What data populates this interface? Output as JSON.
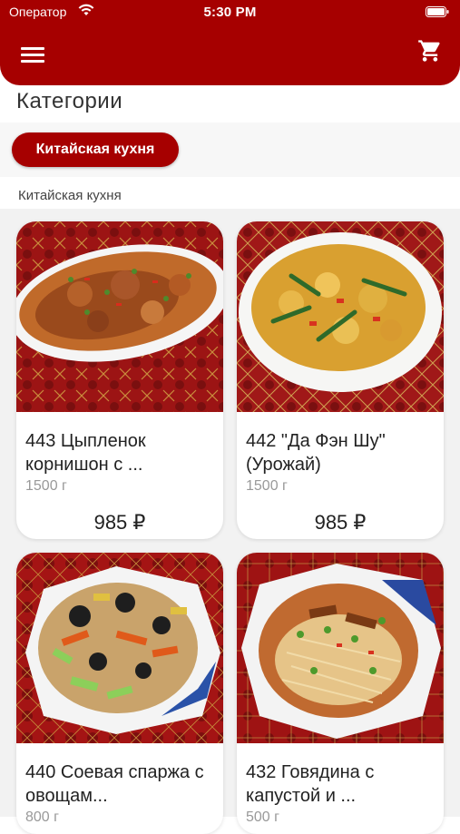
{
  "status_bar": {
    "carrier": "Оператор",
    "time": "5:30 PM"
  },
  "header": {
    "menu_icon": "hamburger-menu-icon",
    "cart_icon": "shopping-cart-icon"
  },
  "categories": {
    "title": "Категории",
    "chips": [
      {
        "label": "Китайская кухня",
        "selected": true
      }
    ]
  },
  "section": {
    "label": "Китайская кухня"
  },
  "products": [
    {
      "name": "443 Цыпленок корнишон с ...",
      "weight": "1500 г",
      "price": "985 ₽"
    },
    {
      "name": "442 \"Да Фэн Шу\" (Урожай)",
      "weight": "1500 г",
      "price": "985 ₽"
    },
    {
      "name": "440 Соевая спаржа с овощам...",
      "weight": "800 г",
      "price": ""
    },
    {
      "name": "432 Говядина с капустой и ...",
      "weight": "500 г",
      "price": ""
    }
  ],
  "colors": {
    "accent": "#a60000",
    "background": "#f2f2f2",
    "card": "#ffffff"
  }
}
